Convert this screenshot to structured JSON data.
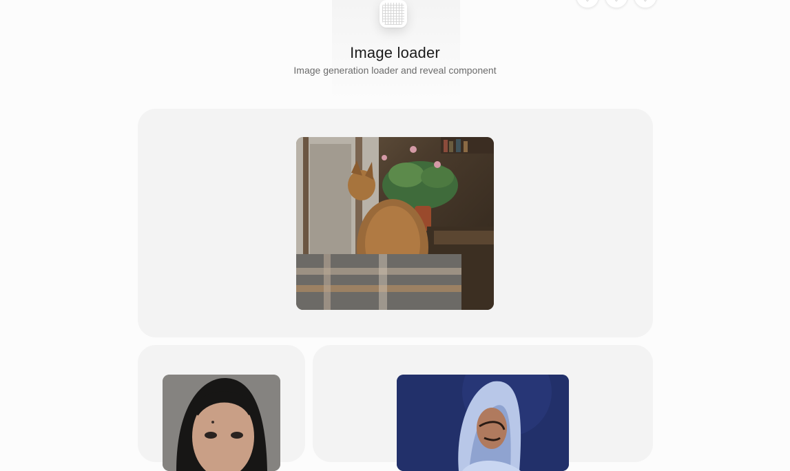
{
  "header": {
    "title": "Image loader",
    "subtitle": "Image generation loader and reveal component"
  },
  "top_actions": [
    {
      "name": "action-1",
      "icon": "circle-icon"
    },
    {
      "name": "action-2",
      "icon": "circle-icon"
    },
    {
      "name": "action-3",
      "icon": "circle-icon"
    }
  ],
  "logo": {
    "icon": "pixel-grid-icon"
  },
  "images": [
    {
      "name": "cat-image",
      "alt": "Cat sitting by a window"
    },
    {
      "name": "woman-portrait-image",
      "alt": "Portrait of a woman"
    },
    {
      "name": "man-hoodie-image",
      "alt": "Man in a light blue hooded jacket"
    }
  ]
}
